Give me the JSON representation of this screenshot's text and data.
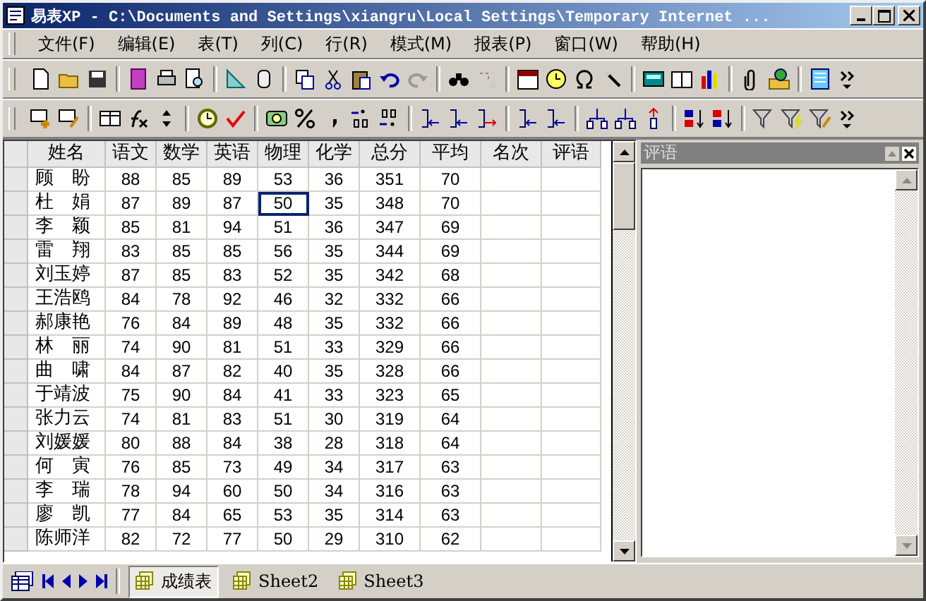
{
  "window": {
    "title": "易表XP  -  C:\\Documents and Settings\\xiangru\\Local Settings\\Temporary Internet ..."
  },
  "menu": [
    "文件(F)",
    "编辑(E)",
    "表(T)",
    "列(C)",
    "行(R)",
    "模式(M)",
    "报表(P)",
    "窗口(W)",
    "帮助(H)"
  ],
  "table": {
    "columns": [
      "姓名",
      "语文",
      "数学",
      "英语",
      "物理",
      "化学",
      "总分",
      "平均",
      "名次",
      "评语"
    ],
    "rows": [
      {
        "cells": [
          {
            "text": "顾　盼",
            "selected": false
          },
          {
            "text": "88",
            "selected": false
          },
          {
            "text": "85",
            "selected": false
          },
          {
            "text": "89",
            "selected": false
          },
          {
            "text": "53",
            "selected": false
          },
          {
            "text": "36",
            "selected": false
          },
          {
            "text": "351",
            "selected": false
          },
          {
            "text": "70",
            "selected": false
          }
        ]
      },
      {
        "cells": [
          {
            "text": "杜　娟",
            "selected": false
          },
          {
            "text": "87",
            "selected": false
          },
          {
            "text": "89",
            "selected": false
          },
          {
            "text": "87",
            "selected": false
          },
          {
            "text": "50",
            "selected": true
          },
          {
            "text": "35",
            "selected": false
          },
          {
            "text": "348",
            "selected": false
          },
          {
            "text": "70",
            "selected": false
          }
        ]
      },
      {
        "cells": [
          {
            "text": "李　颖",
            "selected": false
          },
          {
            "text": "85",
            "selected": false
          },
          {
            "text": "81",
            "selected": false
          },
          {
            "text": "94",
            "selected": false
          },
          {
            "text": "51",
            "selected": false
          },
          {
            "text": "36",
            "selected": false
          },
          {
            "text": "347",
            "selected": false
          },
          {
            "text": "69",
            "selected": false
          }
        ]
      },
      {
        "cells": [
          {
            "text": "雷　翔",
            "selected": false
          },
          {
            "text": "83",
            "selected": false
          },
          {
            "text": "85",
            "selected": false
          },
          {
            "text": "85",
            "selected": false
          },
          {
            "text": "56",
            "selected": false
          },
          {
            "text": "35",
            "selected": false
          },
          {
            "text": "344",
            "selected": false
          },
          {
            "text": "69",
            "selected": false
          }
        ]
      },
      {
        "cells": [
          {
            "text": "刘玉婷",
            "selected": false
          },
          {
            "text": "87",
            "selected": false
          },
          {
            "text": "85",
            "selected": false
          },
          {
            "text": "83",
            "selected": false
          },
          {
            "text": "52",
            "selected": false
          },
          {
            "text": "35",
            "selected": false
          },
          {
            "text": "342",
            "selected": false
          },
          {
            "text": "68",
            "selected": false
          }
        ]
      },
      {
        "cells": [
          {
            "text": "王浩鸥",
            "selected": false
          },
          {
            "text": "84",
            "selected": false
          },
          {
            "text": "78",
            "selected": false
          },
          {
            "text": "92",
            "selected": false
          },
          {
            "text": "46",
            "selected": false
          },
          {
            "text": "32",
            "selected": false
          },
          {
            "text": "332",
            "selected": false
          },
          {
            "text": "66",
            "selected": false
          }
        ]
      },
      {
        "cells": [
          {
            "text": "郝康艳",
            "selected": false
          },
          {
            "text": "76",
            "selected": false
          },
          {
            "text": "84",
            "selected": false
          },
          {
            "text": "89",
            "selected": false
          },
          {
            "text": "48",
            "selected": false
          },
          {
            "text": "35",
            "selected": false
          },
          {
            "text": "332",
            "selected": false
          },
          {
            "text": "66",
            "selected": false
          }
        ]
      },
      {
        "cells": [
          {
            "text": "林　丽",
            "selected": false
          },
          {
            "text": "74",
            "selected": false
          },
          {
            "text": "90",
            "selected": false
          },
          {
            "text": "81",
            "selected": false
          },
          {
            "text": "51",
            "selected": false
          },
          {
            "text": "33",
            "selected": false
          },
          {
            "text": "329",
            "selected": false
          },
          {
            "text": "66",
            "selected": false
          }
        ]
      },
      {
        "cells": [
          {
            "text": "曲　啸",
            "selected": false
          },
          {
            "text": "84",
            "selected": false
          },
          {
            "text": "87",
            "selected": false
          },
          {
            "text": "82",
            "selected": false
          },
          {
            "text": "40",
            "selected": false
          },
          {
            "text": "35",
            "selected": false
          },
          {
            "text": "328",
            "selected": false
          },
          {
            "text": "66",
            "selected": false
          }
        ]
      },
      {
        "cells": [
          {
            "text": "于靖波",
            "selected": false
          },
          {
            "text": "75",
            "selected": false
          },
          {
            "text": "90",
            "selected": false
          },
          {
            "text": "84",
            "selected": false
          },
          {
            "text": "41",
            "selected": false
          },
          {
            "text": "33",
            "selected": false
          },
          {
            "text": "323",
            "selected": false
          },
          {
            "text": "65",
            "selected": false
          }
        ]
      },
      {
        "cells": [
          {
            "text": "张力云",
            "selected": false
          },
          {
            "text": "74",
            "selected": false
          },
          {
            "text": "81",
            "selected": false
          },
          {
            "text": "83",
            "selected": false
          },
          {
            "text": "51",
            "selected": false
          },
          {
            "text": "30",
            "selected": false
          },
          {
            "text": "319",
            "selected": false
          },
          {
            "text": "64",
            "selected": false
          }
        ]
      },
      {
        "cells": [
          {
            "text": "刘媛媛",
            "selected": false
          },
          {
            "text": "80",
            "selected": false
          },
          {
            "text": "88",
            "selected": false
          },
          {
            "text": "84",
            "selected": false
          },
          {
            "text": "38",
            "selected": false
          },
          {
            "text": "28",
            "selected": false
          },
          {
            "text": "318",
            "selected": false
          },
          {
            "text": "64",
            "selected": false
          }
        ]
      },
      {
        "cells": [
          {
            "text": "何　寅",
            "selected": false
          },
          {
            "text": "76",
            "selected": false
          },
          {
            "text": "85",
            "selected": false
          },
          {
            "text": "73",
            "selected": false
          },
          {
            "text": "49",
            "selected": false
          },
          {
            "text": "34",
            "selected": false
          },
          {
            "text": "317",
            "selected": false
          },
          {
            "text": "63",
            "selected": false
          }
        ]
      },
      {
        "cells": [
          {
            "text": "李　瑞",
            "selected": false
          },
          {
            "text": "78",
            "selected": false
          },
          {
            "text": "94",
            "selected": false
          },
          {
            "text": "60",
            "selected": false
          },
          {
            "text": "50",
            "selected": false
          },
          {
            "text": "34",
            "selected": false
          },
          {
            "text": "316",
            "selected": false
          },
          {
            "text": "63",
            "selected": false
          }
        ]
      },
      {
        "cells": [
          {
            "text": "廖　凯",
            "selected": false
          },
          {
            "text": "77",
            "selected": false
          },
          {
            "text": "84",
            "selected": false
          },
          {
            "text": "65",
            "selected": false
          },
          {
            "text": "53",
            "selected": false
          },
          {
            "text": "35",
            "selected": false
          },
          {
            "text": "314",
            "selected": false
          },
          {
            "text": "63",
            "selected": false
          }
        ]
      },
      {
        "cells": [
          {
            "text": "陈师洋",
            "selected": false
          },
          {
            "text": "82",
            "selected": false
          },
          {
            "text": "72",
            "selected": false
          },
          {
            "text": "77",
            "selected": false
          },
          {
            "text": "50",
            "selected": false
          },
          {
            "text": "29",
            "selected": false
          },
          {
            "text": "310",
            "selected": false
          },
          {
            "text": "62",
            "selected": false
          }
        ]
      }
    ]
  },
  "panel": {
    "title": "评语"
  },
  "sheet_tabs": [
    {
      "label": "成绩表",
      "selected": true
    },
    {
      "label": "Sheet2",
      "selected": false
    },
    {
      "label": "Sheet3",
      "selected": false
    }
  ]
}
